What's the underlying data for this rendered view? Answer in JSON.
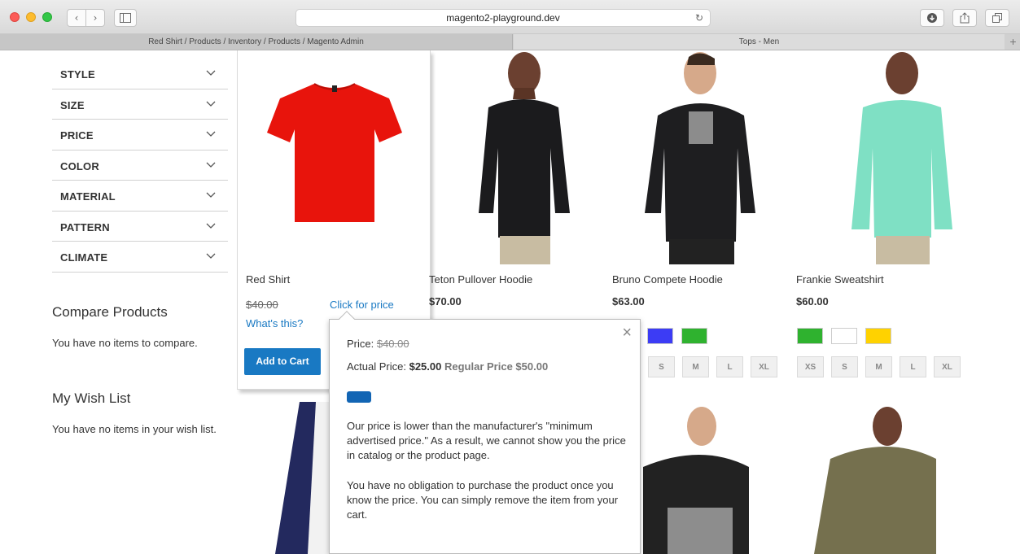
{
  "browser": {
    "url": "magento2-playground.dev",
    "tabs": [
      {
        "label": "Red Shirt / Products / Inventory / Products / Magento Admin"
      },
      {
        "label": "Tops - Men"
      }
    ],
    "add_tab_label": "+"
  },
  "filters": [
    {
      "label": "STYLE"
    },
    {
      "label": "SIZE"
    },
    {
      "label": "PRICE"
    },
    {
      "label": "COLOR"
    },
    {
      "label": "MATERIAL"
    },
    {
      "label": "PATTERN"
    },
    {
      "label": "CLIMATE"
    }
  ],
  "compare": {
    "title": "Compare Products",
    "text": "You have no items to compare."
  },
  "wishlist": {
    "title": "My Wish List",
    "text": "You have no items in your wish list."
  },
  "featured_product": {
    "name": "Red Shirt",
    "old_price": "$40.00",
    "click_for_price": "Click for price",
    "whats_this": "What's this?",
    "add_to_cart": "Add to Cart"
  },
  "products": [
    {
      "name": "Teton Pullover Hoodie",
      "price": "$70.00"
    },
    {
      "name": "Bruno Compete Hoodie",
      "price": "$63.00"
    },
    {
      "name": "Frankie Sweatshirt",
      "price": "$60.00"
    }
  ],
  "swatches": {
    "bruno_colors": [
      "#3c3cf5",
      "#2fb22f"
    ],
    "frankie_colors": [
      "#2fb22f",
      "#ffffff",
      "#ffd200"
    ],
    "bruno_sizes": [
      "S",
      "M",
      "L",
      "XL"
    ],
    "frankie_sizes": [
      "XS",
      "S",
      "M",
      "L",
      "XL"
    ]
  },
  "popup": {
    "price_label": "Price: ",
    "price_value": "$40.00",
    "actual_label": "Actual Price: ",
    "actual_value": "$25.00",
    "regular_label": "Regular Price $50.00",
    "para1": "Our price is lower than the manufacturer's \"minimum advertised price.\" As a result, we cannot show you the price in catalog or the product page.",
    "para2": "You have no obligation to purchase the product once you know the price. You can simply remove the item from your cart.",
    "close": "×"
  },
  "colors": {
    "link": "#1979c3",
    "button": "#1979c3",
    "shirt": "#e8140c"
  }
}
